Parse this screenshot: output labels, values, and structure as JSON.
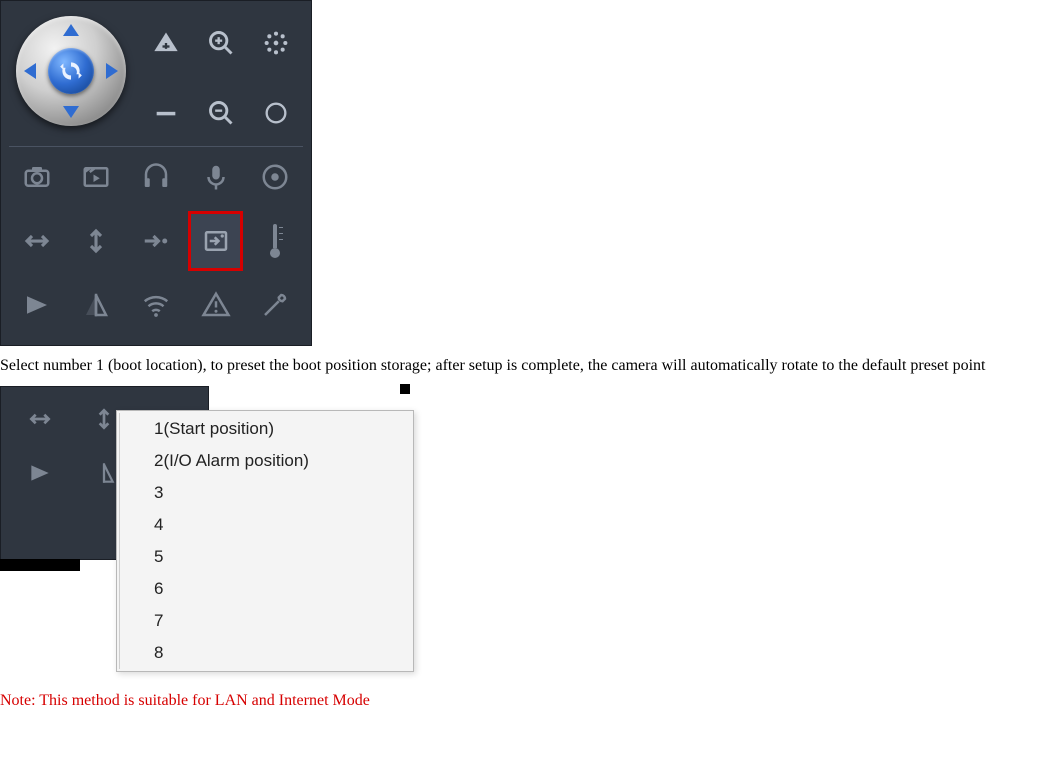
{
  "paragraph1": "Select number 1 (boot location), to preset the boot position storage; after setup is complete, the camera will automatically rotate to the default preset point",
  "note": "Note: This method is suitable for LAN and Internet Mode",
  "preset_options": [
    "1(Start position)",
    "2(I/O Alarm position)",
    "3",
    "4",
    "5",
    "6",
    "7",
    "8"
  ],
  "panel1": {
    "side_icons_col1": [
      "zoom-in-triangle",
      "zoom-out-triangle"
    ],
    "side_icons_col2": [
      "magnify-plus",
      "magnify-minus"
    ],
    "side_icons_col3": [
      "iris-dotted",
      "iris-ring"
    ],
    "grid_icons": [
      [
        "camera-icon",
        "clapper-icon",
        "headphones-icon",
        "mic-icon",
        "disc-icon"
      ],
      [
        "hflip-icon",
        "vflip-icon",
        "goto-icon",
        "preset-icon",
        "thermometer-icon"
      ],
      [
        "flag-icon",
        "mirror-icon",
        "wifi-icon",
        "alert-icon",
        "wrench-icon"
      ]
    ],
    "highlighted": "preset-icon"
  },
  "panel2": {
    "left_grid_icons": [
      [
        "hflip-icon",
        "vflip-icon",
        "goto-icon"
      ],
      [
        "flag-icon",
        "mirror-icon",
        "wifi-icon"
      ],
      [
        "blank",
        "blank",
        "blank"
      ]
    ]
  }
}
